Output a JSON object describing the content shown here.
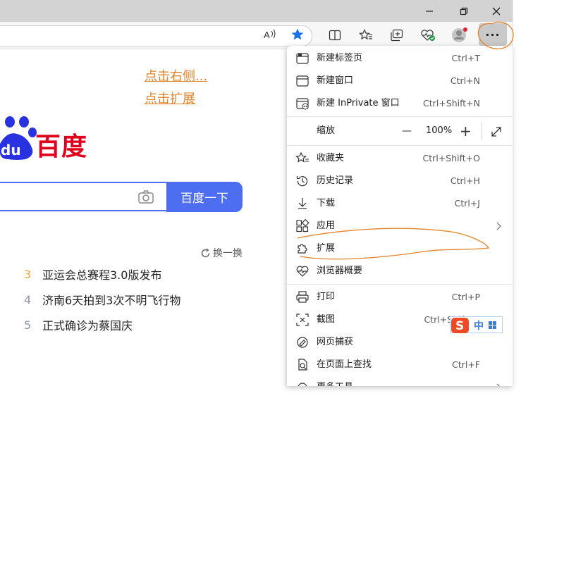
{
  "window": {
    "minimize_label": "—",
    "restore_label": "❐",
    "close_label": "✕"
  },
  "toolbar": {
    "read_aloud_icon": "read-aloud-icon",
    "favorite_icon": "star-filled-icon",
    "more_label": "···"
  },
  "page": {
    "link_right": "点击右侧...",
    "link_extension": "点击扩展",
    "logo_text": "百度",
    "logo_du": "du",
    "search_button": "百度一下",
    "refresh_label": "换一换",
    "hot_list": [
      {
        "num": "3",
        "text": "亚运会总赛程3.0版发布",
        "color": "#f4a23b"
      },
      {
        "num": "4",
        "text": "济南6天拍到3次不明飞行物",
        "color": "#9195a3"
      },
      {
        "num": "5",
        "text": "正式确诊为蔡国庆",
        "color": "#9195a3"
      }
    ]
  },
  "menu": {
    "items": [
      {
        "label": "新建标签页",
        "shortcut": "Ctrl+T"
      },
      {
        "label": "新建窗口",
        "shortcut": "Ctrl+N"
      },
      {
        "label": "新建 InPrivate 窗口",
        "shortcut": "Ctrl+Shift+N"
      },
      {
        "label": "收藏夹",
        "shortcut": "Ctrl+Shift+O"
      },
      {
        "label": "历史记录",
        "shortcut": "Ctrl+H"
      },
      {
        "label": "下载",
        "shortcut": "Ctrl+J"
      },
      {
        "label": "应用",
        "shortcut": ""
      },
      {
        "label": "扩展",
        "shortcut": ""
      },
      {
        "label": "浏览器概要",
        "shortcut": ""
      },
      {
        "label": "打印",
        "shortcut": "Ctrl+P"
      },
      {
        "label": "截图",
        "shortcut": "Ctrl+Shift+S"
      },
      {
        "label": "网页捕获",
        "shortcut": ""
      },
      {
        "label": "在页面上查找",
        "shortcut": "Ctrl+F"
      },
      {
        "label": "更多工具",
        "shortcut": ""
      }
    ],
    "zoom": {
      "label": "缩放",
      "minus": "—",
      "value": "100%",
      "plus": "+"
    }
  },
  "ime": {
    "mode_label": "中"
  },
  "colors": {
    "accent": "#4e6ef2",
    "baidu_red": "#e0001b",
    "annotation": "#e2842a"
  }
}
